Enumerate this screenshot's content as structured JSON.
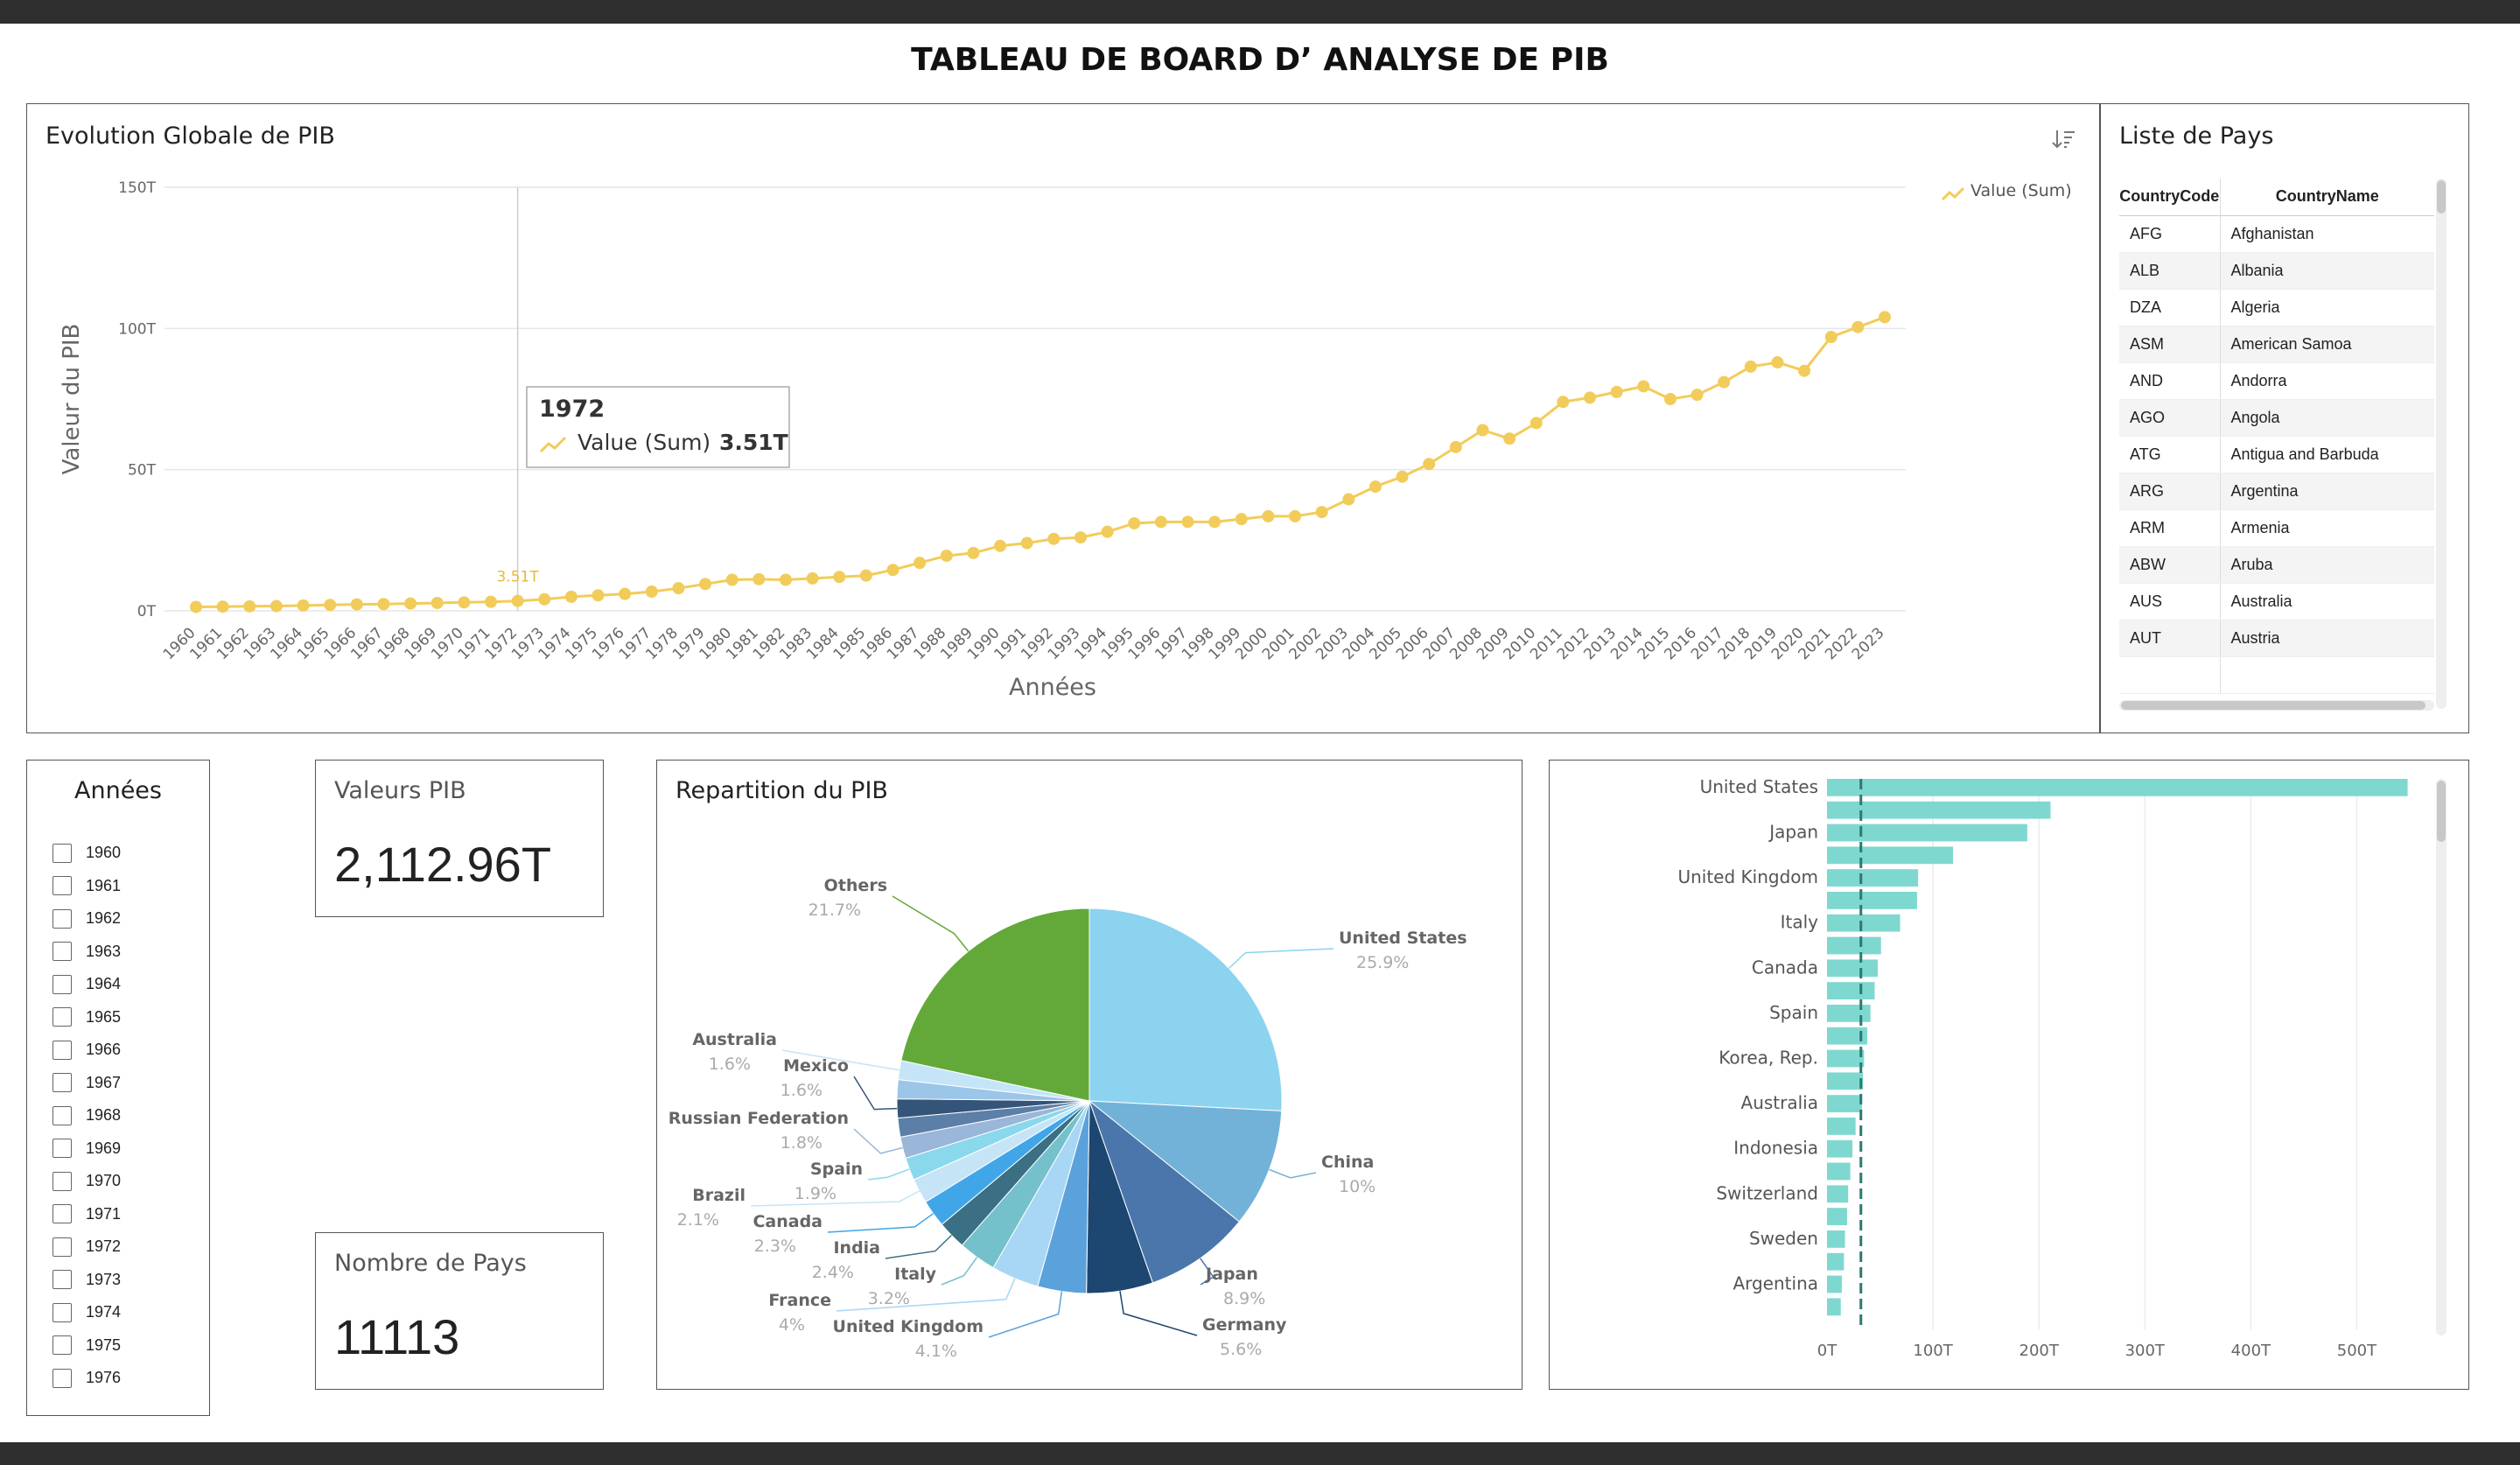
{
  "page": {
    "title": "TABLEAU DE BOARD D’ ANALYSE DE PIB"
  },
  "colors": {
    "line": "#f2cc5a",
    "bar": "#7fd8d0",
    "bar_dash": "#2a7a73",
    "border": "#555555"
  },
  "line_chart": {
    "title": "Evolution Globale de PIB",
    "legend": "Value (Sum)",
    "sort_icon": "sort-icon",
    "tooltip": {
      "year": "1972",
      "series": "Value (Sum)",
      "value": "3.51T"
    },
    "point_label": "3.51T"
  },
  "country_list": {
    "title": "Liste de Pays",
    "headers": [
      "CountryCode",
      "CountryName"
    ],
    "rows": [
      [
        "AFG",
        "Afghanistan"
      ],
      [
        "ALB",
        "Albania"
      ],
      [
        "DZA",
        "Algeria"
      ],
      [
        "ASM",
        "American Samoa"
      ],
      [
        "AND",
        "Andorra"
      ],
      [
        "AGO",
        "Angola"
      ],
      [
        "ATG",
        "Antigua and Barbuda"
      ],
      [
        "ARG",
        "Argentina"
      ],
      [
        "ARM",
        "Armenia"
      ],
      [
        "ABW",
        "Aruba"
      ],
      [
        "AUS",
        "Australia"
      ],
      [
        "AUT",
        "Austria"
      ]
    ]
  },
  "years_filter": {
    "title": "Années",
    "items": [
      "1960",
      "1961",
      "1962",
      "1963",
      "1964",
      "1965",
      "1966",
      "1967",
      "1968",
      "1969",
      "1970",
      "1971",
      "1972",
      "1973",
      "1974",
      "1975",
      "1976"
    ]
  },
  "kpi_pib": {
    "label": "Valeurs PIB",
    "value": "2,112.96T"
  },
  "kpi_pays": {
    "label": "Nombre de Pays",
    "value": "11113"
  },
  "pie": {
    "title": "Repartition du PIB"
  },
  "chart_data": [
    {
      "type": "line",
      "title": "Evolution Globale de PIB",
      "xlabel": "Années",
      "ylabel": "Valeur du PIB",
      "ylim": [
        0,
        150
      ],
      "yticks": [
        "0T",
        "50T",
        "100T",
        "150T"
      ],
      "series": [
        {
          "name": "Value (Sum)",
          "unit": "T",
          "x": [
            1960,
            1961,
            1962,
            1963,
            1964,
            1965,
            1966,
            1967,
            1968,
            1969,
            1970,
            1971,
            1972,
            1973,
            1974,
            1975,
            1976,
            1977,
            1978,
            1979,
            1980,
            1981,
            1982,
            1983,
            1984,
            1985,
            1986,
            1987,
            1988,
            1989,
            1990,
            1991,
            1992,
            1993,
            1994,
            1995,
            1996,
            1997,
            1998,
            1999,
            2000,
            2001,
            2002,
            2003,
            2004,
            2005,
            2006,
            2007,
            2008,
            2009,
            2010,
            2011,
            2012,
            2013,
            2014,
            2015,
            2016,
            2017,
            2018,
            2019,
            2020,
            2021,
            2022,
            2023
          ],
          "values": [
            1.4,
            1.5,
            1.6,
            1.7,
            1.9,
            2.1,
            2.3,
            2.4,
            2.6,
            2.8,
            3.0,
            3.2,
            3.51,
            4.1,
            5.0,
            5.5,
            6.0,
            6.8,
            8.0,
            9.5,
            11.0,
            11.2,
            11.0,
            11.5,
            12.0,
            12.5,
            14.5,
            17.0,
            19.5,
            20.5,
            23.0,
            24.0,
            25.5,
            26.0,
            28.0,
            31.0,
            31.5,
            31.5,
            31.5,
            32.5,
            33.5,
            33.5,
            35.0,
            39.5,
            44.0,
            47.5,
            52.0,
            58.0,
            64.0,
            61.0,
            66.5,
            74.0,
            75.5,
            77.5,
            79.5,
            75.0,
            76.5,
            81.0,
            86.5,
            88.0,
            85.0,
            97.0,
            100.5,
            104.0
          ]
        }
      ],
      "grid": true,
      "legend_position": "top-right"
    },
    {
      "type": "pie",
      "title": "Repartition du PIB",
      "slices": [
        {
          "label": "United States",
          "value": 25.9,
          "pct": "25.9%",
          "color": "#8cd3f0"
        },
        {
          "label": "China",
          "value": 10.0,
          "pct": "10%",
          "color": "#72b2d8"
        },
        {
          "label": "Japan",
          "value": 8.9,
          "pct": "8.9%",
          "color": "#4a76ab"
        },
        {
          "label": "Germany",
          "value": 5.6,
          "pct": "5.6%",
          "color": "#1d4670"
        },
        {
          "label": "United Kingdom",
          "value": 4.1,
          "pct": "4.1%",
          "color": "#5ba2dc"
        },
        {
          "label": "France",
          "value": 4.0,
          "pct": "4%",
          "color": "#a8d6f5"
        },
        {
          "label": "Italy",
          "value": 3.2,
          "pct": "3.2%",
          "color": "#74c1cb"
        },
        {
          "label": "India",
          "value": 2.4,
          "pct": "2.4%",
          "color": "#3a6f84"
        },
        {
          "label": "Canada",
          "value": 2.3,
          "pct": "2.3%",
          "color": "#40a6e8"
        },
        {
          "label": "Brazil",
          "value": 2.1,
          "pct": "2.1%",
          "color": "#c5e5f7"
        },
        {
          "label": "Spain",
          "value": 1.9,
          "pct": "1.9%",
          "color": "#8ad8ec"
        },
        {
          "label": "Russian Federation",
          "value": 1.8,
          "pct": "1.8%",
          "color": "#9ab6d8"
        },
        {
          "label": "",
          "value": 1.6,
          "pct": "",
          "color": "#5c7fa8"
        },
        {
          "label": "Mexico",
          "value": 1.6,
          "pct": "1.6%",
          "color": "#34547a"
        },
        {
          "label": "",
          "value": 1.6,
          "pct": "",
          "color": "#9cc6e8"
        },
        {
          "label": "Australia",
          "value": 1.6,
          "pct": "1.6%",
          "color": "#c5e4f7"
        },
        {
          "label": "Others",
          "value": 21.7,
          "pct": "21.7%",
          "color": "#62a93a"
        }
      ]
    },
    {
      "type": "bar",
      "orientation": "horizontal",
      "xlim": [
        0,
        550
      ],
      "xticks": [
        "0T",
        "100T",
        "200T",
        "300T",
        "400T",
        "500T"
      ],
      "categories": [
        "United States",
        "",
        "Japan",
        "",
        "United Kingdom",
        "",
        "Italy",
        "",
        "Canada",
        "",
        "Spain",
        "",
        "Korea, Rep.",
        "",
        "Australia",
        "",
        "Indonesia",
        "",
        "Switzerland",
        "",
        "Sweden",
        "",
        "Argentina",
        ""
      ],
      "values": [
        548,
        211,
        189,
        119,
        86,
        85,
        69,
        51,
        48,
        45,
        41,
        38,
        35,
        34,
        33,
        27,
        24,
        22,
        20,
        19,
        17,
        16,
        14,
        13
      ],
      "reference_line": 32
    }
  ]
}
